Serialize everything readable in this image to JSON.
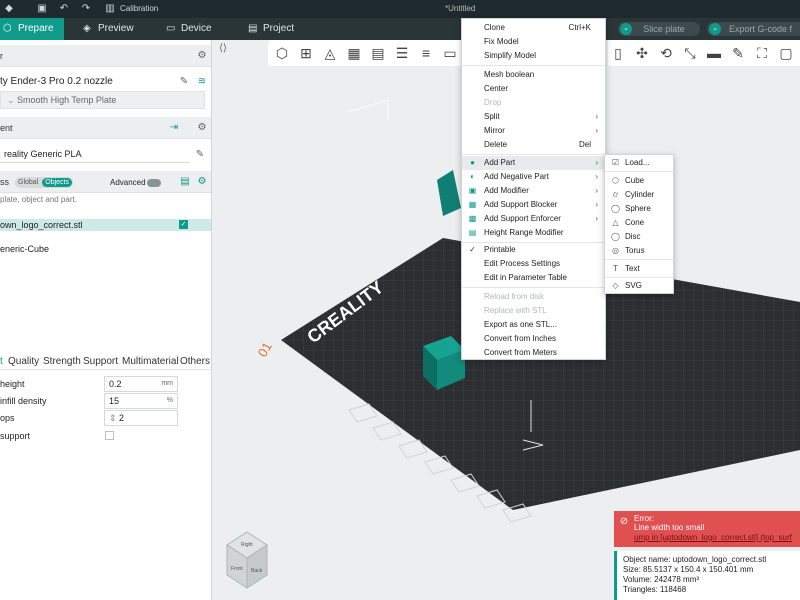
{
  "titlebar": {
    "calibration": "Calibration",
    "window_title": "*Untitled"
  },
  "tabs": {
    "prepare": "Prepare",
    "preview": "Preview",
    "device": "Device",
    "project": "Project"
  },
  "header_buttons": {
    "slice_plate": "Slice plate",
    "export_gcode": "Export G-code f"
  },
  "left": {
    "printer_title": "r",
    "printer_name": "ty Ender-3 Pro 0.2 nozzle",
    "plate_type": "Smooth High Temp Plate",
    "filament_title": "ent",
    "filament_name": "reality Generic PLA",
    "process_title": "ss",
    "toggle_global": "Global",
    "toggle_objects": "Objects",
    "advanced": "Advanced",
    "hint": "plate, object and part.",
    "object_file": "own_logo_correct.stl",
    "object_child": "eneric-Cube",
    "param_tabs": [
      "t",
      "Quality",
      "Strength",
      "Support",
      "Multimaterial",
      "Others"
    ],
    "params": [
      {
        "label": "height",
        "value": "0.2",
        "unit": "mm"
      },
      {
        "label": " infill density",
        "value": "15",
        "unit": "%"
      },
      {
        "label": "ops",
        "value": "2",
        "unit": ""
      },
      {
        "label": " support",
        "value": "",
        "unit": ""
      }
    ]
  },
  "context_menu": [
    {
      "label": "Clone",
      "shortcut": "Ctrl+K",
      "disabled": false
    },
    {
      "label": "Fix Model",
      "shortcut": "",
      "disabled": false
    },
    {
      "label": "Simplify Model",
      "shortcut": "",
      "disabled": false
    },
    {
      "label": "Mesh boolean",
      "shortcut": "",
      "disabled": false
    },
    {
      "label": "Center",
      "shortcut": "",
      "disabled": false
    },
    {
      "label": "Drop",
      "shortcut": "",
      "disabled": true
    },
    {
      "label": "Split",
      "shortcut": "",
      "disabled": false
    },
    {
      "label": "Mirror",
      "shortcut": "",
      "disabled": false
    },
    {
      "label": "Delete",
      "shortcut": "Del",
      "disabled": false
    },
    {
      "label": "Add Part",
      "shortcut": "",
      "disabled": false
    },
    {
      "label": "Add Negative Part",
      "shortcut": "",
      "disabled": false
    },
    {
      "label": "Add Modifier",
      "shortcut": "",
      "disabled": false
    },
    {
      "label": "Add Support Blocker",
      "shortcut": "",
      "disabled": false
    },
    {
      "label": "Add Support Enforcer",
      "shortcut": "",
      "disabled": false
    },
    {
      "label": "Height Range Modifier",
      "shortcut": "",
      "disabled": false
    },
    {
      "label": "Printable",
      "shortcut": "",
      "disabled": false
    },
    {
      "label": "Edit Process Settings",
      "shortcut": "",
      "disabled": false
    },
    {
      "label": "Edit in Parameter Table",
      "shortcut": "",
      "disabled": false
    },
    {
      "label": "Reload from disk",
      "shortcut": "",
      "disabled": true
    },
    {
      "label": "Replace with STL",
      "shortcut": "",
      "disabled": true
    },
    {
      "label": "Export as one STL...",
      "shortcut": "",
      "disabled": false
    },
    {
      "label": "Convert from Inches",
      "shortcut": "",
      "disabled": false
    },
    {
      "label": "Convert from Meters",
      "shortcut": "",
      "disabled": false
    }
  ],
  "submenu": [
    "Load...",
    "Cube",
    "Cylinder",
    "Sphere",
    "Cone",
    "Disc",
    "Torus",
    "Text",
    "SVG"
  ],
  "plate_text": {
    "brand": "CREALITY",
    "plate_number": "01"
  },
  "viewcube": {
    "front": "Front",
    "back": "Back",
    "right": "Right"
  },
  "error": {
    "title": "Error:",
    "message": "Line width too small",
    "detail": "ump in [uptodown_logo_correct.stl] (top_surf"
  },
  "info": {
    "name": "Object name: uptodown_logo_correct.stl",
    "size": "Size: 85.5137 x 150.4 x 150.401 mm",
    "volume": "Volume: 242478 mm³",
    "triangles": "Triangles: 118468"
  },
  "colors": {
    "accent": "#0f9a8b",
    "error": "#e05050",
    "plate": "#2b2f31"
  }
}
